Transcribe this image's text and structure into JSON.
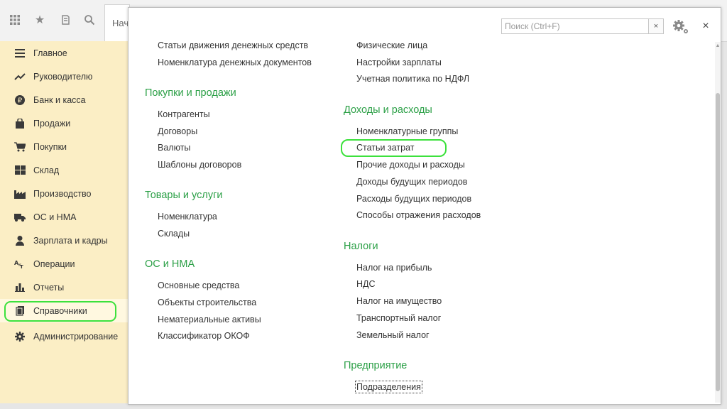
{
  "tabs": {
    "home_label": "Начальная страница"
  },
  "sidebar": {
    "items": [
      {
        "label": "Главное",
        "icon": "menu-icon"
      },
      {
        "label": "Руководителю",
        "icon": "trend-icon"
      },
      {
        "label": "Банк и касса",
        "icon": "ruble-icon"
      },
      {
        "label": "Продажи",
        "icon": "bag-icon"
      },
      {
        "label": "Покупки",
        "icon": "cart-icon"
      },
      {
        "label": "Склад",
        "icon": "warehouse-icon"
      },
      {
        "label": "Производство",
        "icon": "factory-icon"
      },
      {
        "label": "ОС и НМА",
        "icon": "truck-icon"
      },
      {
        "label": "Зарплата и кадры",
        "icon": "person-icon"
      },
      {
        "label": "Операции",
        "icon": "operations-icon"
      },
      {
        "label": "Отчеты",
        "icon": "chart-icon"
      },
      {
        "label": "Справочники",
        "icon": "books-icon"
      },
      {
        "label": "Администрирование",
        "icon": "gear-icon"
      }
    ]
  },
  "search": {
    "placeholder": "Поиск (Ctrl+F)",
    "value": ""
  },
  "sections": {
    "money": {
      "links": [
        "Статьи движения денежных средств",
        "Номенклатура денежных документов"
      ]
    },
    "purchases": {
      "title": "Покупки и продажи",
      "links": [
        "Контрагенты",
        "Договоры",
        "Валюты",
        "Шаблоны договоров"
      ]
    },
    "goods": {
      "title": "Товары и услуги",
      "links": [
        "Номенклатура",
        "Склады"
      ]
    },
    "assets": {
      "title": "ОС и НМА",
      "links": [
        "Основные средства",
        "Объекты строительства",
        "Нематериальные активы",
        "Классификатор ОКОФ"
      ]
    },
    "salary": {
      "links": [
        "Физические лица",
        "Настройки зарплаты",
        "Учетная политика по НДФЛ"
      ]
    },
    "income": {
      "title": "Доходы и расходы",
      "links": [
        "Номенклатурные группы",
        "Статьи затрат",
        "Прочие доходы и расходы",
        "Доходы будущих периодов",
        "Расходы будущих периодов",
        "Способы отражения расходов"
      ]
    },
    "taxes": {
      "title": "Налоги",
      "links": [
        "Налог на прибыль",
        "НДС",
        "Налог на имущество",
        "Транспортный налог",
        "Земельный налог"
      ]
    },
    "enterprise": {
      "title": "Предприятие",
      "links": [
        "Подразделения"
      ]
    }
  },
  "colors": {
    "sidebar_bg": "#fbeec5",
    "section_title": "#2ca047",
    "highlight": "#3ce13c"
  }
}
